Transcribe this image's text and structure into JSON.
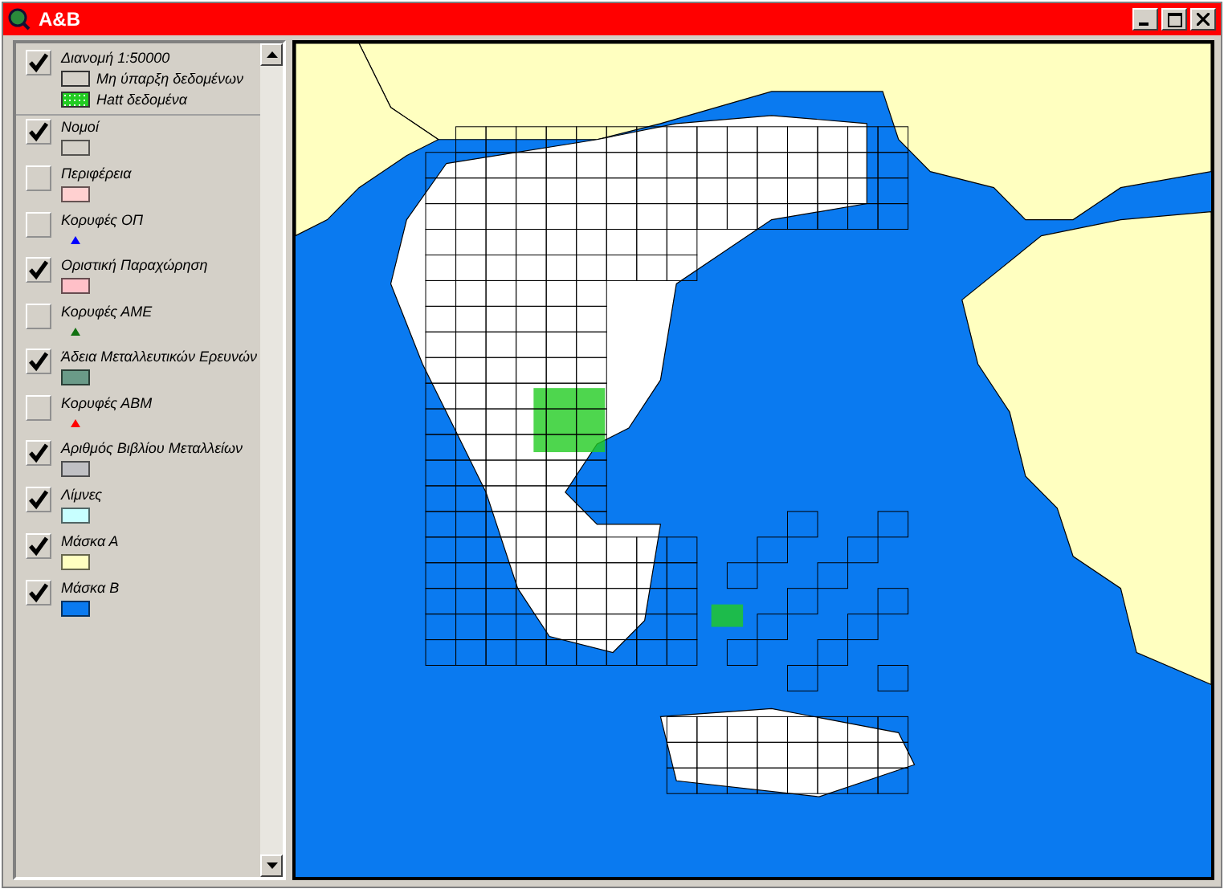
{
  "window": {
    "title": "A&B"
  },
  "legend": [
    {
      "label": "Διανομή 1:50000",
      "checked": true,
      "classes": [
        {
          "label": "Μη ύπαρξη δεδομένων",
          "kind": "box",
          "color": "#d4d0c8"
        },
        {
          "label": "Hatt δεδομένα",
          "kind": "pattern",
          "color": "#22cc22"
        }
      ]
    },
    {
      "label": "Νομοί",
      "checked": true,
      "symbol": {
        "kind": "box",
        "color": "#d4d0c8"
      }
    },
    {
      "label": "Περιφέρεια",
      "checked": false,
      "symbol": {
        "kind": "box",
        "color": "#ffd0d0"
      }
    },
    {
      "label": "Κορυφές ΟΠ",
      "checked": false,
      "symbol": {
        "kind": "triangle",
        "color": "#0000ff"
      }
    },
    {
      "label": "Οριστική Παραχώρηση",
      "checked": true,
      "symbol": {
        "kind": "box",
        "color": "#ffc0c8"
      }
    },
    {
      "label": "Κορυφές ΑΜΕ",
      "checked": false,
      "symbol": {
        "kind": "triangle",
        "color": "#107010"
      }
    },
    {
      "label": "Άδεια Μεταλλευτικών Ερευνών",
      "checked": true,
      "symbol": {
        "kind": "box",
        "color": "#6a9a88"
      }
    },
    {
      "label": "Κορυφές ΑΒΜ",
      "checked": false,
      "symbol": {
        "kind": "triangle",
        "color": "#ff0000"
      }
    },
    {
      "label": "Αριθμός Βιβλίου Μεταλλείων",
      "checked": true,
      "symbol": {
        "kind": "box",
        "color": "#c0c0c4"
      }
    },
    {
      "label": "Λίμνες",
      "checked": true,
      "symbol": {
        "kind": "box",
        "color": "#c8ffff"
      }
    },
    {
      "label": "Μάσκα Α",
      "checked": true,
      "symbol": {
        "kind": "box",
        "color": "#ffffc0"
      }
    },
    {
      "label": "Μάσκα Β",
      "checked": true,
      "symbol": {
        "kind": "box",
        "color": "#0a7af0"
      }
    }
  ]
}
